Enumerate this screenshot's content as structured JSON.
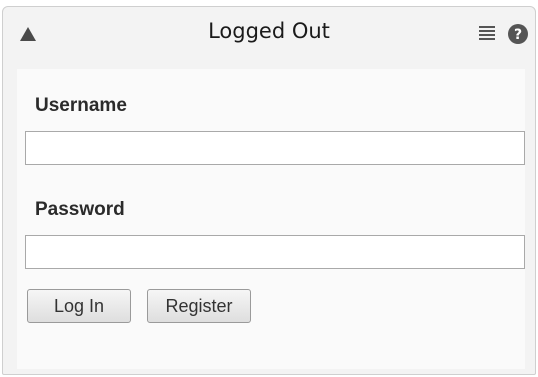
{
  "window": {
    "title": "Logged Out",
    "collapse_icon": "triangle-up-icon",
    "menu_icon": "hamburger-menu-icon",
    "help_icon": "question-circle-icon"
  },
  "login_form": {
    "username_label": "Username",
    "username_value": "",
    "password_label": "Password",
    "password_value": "",
    "login_button": "Log In",
    "register_button": "Register"
  }
}
